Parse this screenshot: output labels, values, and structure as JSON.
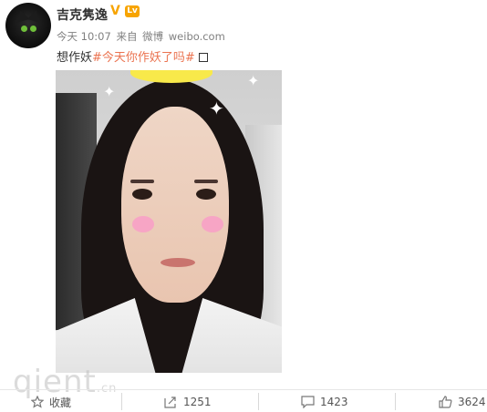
{
  "user": {
    "name": "吉克隽逸",
    "verified_mark": "V",
    "level_badge": "Lv"
  },
  "meta": {
    "time": "今天 10:07",
    "source_prefix": "来自",
    "source_app": "微博",
    "source_site": "weibo.com"
  },
  "post": {
    "text": "想作妖",
    "hashtag": "#今天你作妖了吗#"
  },
  "watermark": {
    "text": "qient",
    "suffix": ".cn"
  },
  "actions": [
    {
      "label": "收藏",
      "icon": "star-icon"
    },
    {
      "label": "1251",
      "icon": "share-icon"
    },
    {
      "label": "1423",
      "icon": "comment-icon"
    },
    {
      "label": "3624",
      "icon": "like-icon"
    }
  ],
  "colors": {
    "hashtag": "#eb7350",
    "meta": "#808080",
    "verified": "#f7a400"
  }
}
